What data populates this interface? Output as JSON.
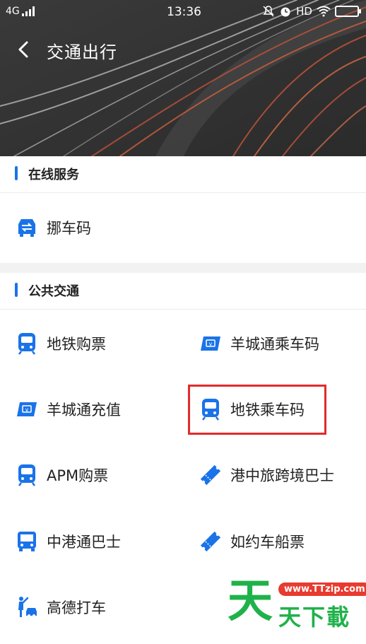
{
  "status_bar": {
    "network": "4G",
    "time": "13:36",
    "hd": "HD"
  },
  "nav": {
    "title": "交通出行"
  },
  "online_service": {
    "title": "在线服务",
    "items": [
      {
        "label": "挪车码",
        "icon": "car-swap-icon"
      }
    ]
  },
  "public_transport": {
    "title": "公共交通",
    "items": [
      {
        "label": "地铁购票",
        "icon": "metro-icon"
      },
      {
        "label": "羊城通乘车码",
        "icon": "transit-card-icon"
      },
      {
        "label": "羊城通充值",
        "icon": "transit-card-icon"
      },
      {
        "label": "地铁乘车码",
        "icon": "metro-icon"
      },
      {
        "label": "APM购票",
        "icon": "metro-icon"
      },
      {
        "label": "港中旅跨境巴士",
        "icon": "ticket-icon"
      },
      {
        "label": "中港通巴士",
        "icon": "bus-icon"
      },
      {
        "label": "如约车船票",
        "icon": "ticket-icon"
      },
      {
        "label": "高德打车",
        "icon": "taxi-hail-icon"
      }
    ]
  },
  "watermark": {
    "big": "天",
    "small": "天下載",
    "url": "www.TTzip.com"
  },
  "colors": {
    "accent": "#1a73e8",
    "highlight": "#e12b2b",
    "watermark_green": "#1fb24a"
  }
}
